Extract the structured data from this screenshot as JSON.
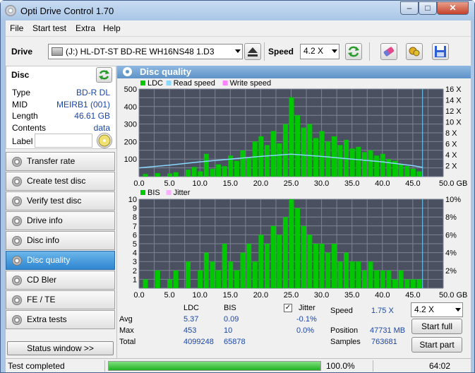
{
  "app": {
    "title": "Opti Drive Control 1.70"
  },
  "window_buttons": {
    "minimize": "–",
    "maximize": "□",
    "close": "✕"
  },
  "menu": [
    "File",
    "Start test",
    "Extra",
    "Help"
  ],
  "toolbar": {
    "drive_label": "Drive",
    "drive_value": "(J:)   HL-DT-ST BD-RE  WH16NS48 1.D3",
    "speed_label": "Speed",
    "speed_value": "4.2 X"
  },
  "disc": {
    "header": "Disc",
    "rows": [
      {
        "label": "Type",
        "value": "BD-R DL"
      },
      {
        "label": "MID",
        "value": "MEIRB1 (001)"
      },
      {
        "label": "Length",
        "value": "46.61 GB"
      },
      {
        "label": "Contents",
        "value": "data"
      }
    ],
    "label_label": "Label",
    "label_value": ""
  },
  "nav": [
    {
      "label": "Transfer rate",
      "active": false
    },
    {
      "label": "Create test disc",
      "active": false
    },
    {
      "label": "Verify test disc",
      "active": false
    },
    {
      "label": "Drive info",
      "active": false
    },
    {
      "label": "Disc info",
      "active": false
    },
    {
      "label": "Disc quality",
      "active": true
    },
    {
      "label": "CD Bler",
      "active": false
    },
    {
      "label": "FE / TE",
      "active": false
    },
    {
      "label": "Extra tests",
      "active": false
    }
  ],
  "status_window_button": "Status window >>",
  "panel": {
    "title": "Disc quality"
  },
  "chart_data": [
    {
      "type": "bar",
      "legend": [
        "LDC",
        "Read speed",
        "Write speed"
      ],
      "colors": {
        "LDC": "#00c800",
        "Read speed": "#88d8ff",
        "Write speed": "#ff80ff",
        "background": "#4a5060",
        "grid": "#7c8494"
      },
      "x_ticks": [
        "0.0",
        "5.0",
        "10.0",
        "15.0",
        "20.0",
        "25.0",
        "30.0",
        "35.0",
        "40.0",
        "45.0",
        "50.0 GB"
      ],
      "y_ticks": [
        "500",
        "400",
        "300",
        "200",
        "100"
      ],
      "y2_ticks": [
        "16 X",
        "14 X",
        "12 X",
        "10 X",
        "8 X",
        "6 X",
        "4 X",
        "2 X"
      ],
      "xlim": [
        0,
        50
      ],
      "ylim": [
        0,
        500
      ],
      "y2lim": [
        0,
        16
      ],
      "x": [
        1,
        3,
        5,
        6,
        8,
        9,
        10,
        11,
        12,
        13,
        14,
        15,
        16,
        17,
        18,
        19,
        20,
        21,
        22,
        23,
        24,
        25,
        26,
        27,
        28,
        29,
        30,
        31,
        32,
        33,
        34,
        35,
        36,
        37,
        38,
        39,
        40,
        41,
        42,
        43,
        44,
        45,
        46
      ],
      "values": [
        15,
        20,
        18,
        25,
        40,
        55,
        30,
        130,
        45,
        70,
        60,
        120,
        90,
        150,
        110,
        200,
        230,
        180,
        260,
        190,
        300,
        453,
        350,
        280,
        300,
        220,
        260,
        200,
        230,
        180,
        210,
        160,
        170,
        140,
        150,
        120,
        130,
        100,
        90,
        70,
        60,
        45,
        30
      ],
      "read_speed": {
        "x": [
          0,
          5,
          10,
          15,
          20,
          25,
          30,
          35,
          40,
          45,
          46.6
        ],
        "y": [
          1.6,
          2.1,
          2.7,
          3.2,
          3.7,
          4.1,
          3.7,
          3.2,
          2.7,
          2.0,
          1.7
        ]
      },
      "marker_x": 46.6
    },
    {
      "type": "bar",
      "legend": [
        "BIS",
        "Jitter"
      ],
      "colors": {
        "BIS": "#00c800",
        "Jitter": "#ffb0ff"
      },
      "x_ticks": [
        "0.0",
        "5.0",
        "10.0",
        "15.0",
        "20.0",
        "25.0",
        "30.0",
        "35.0",
        "40.0",
        "45.0",
        "50.0 GB"
      ],
      "y_ticks": [
        "10",
        "9",
        "8",
        "7",
        "6",
        "5",
        "4",
        "3",
        "2",
        "1"
      ],
      "y2_ticks": [
        "10%",
        "8%",
        "6%",
        "4%",
        "2%"
      ],
      "xlim": [
        0,
        50
      ],
      "ylim": [
        0,
        10
      ],
      "y2lim": [
        0,
        10
      ],
      "x": [
        1,
        3,
        5,
        6,
        8,
        10,
        11,
        12,
        13,
        14,
        15,
        16,
        17,
        18,
        19,
        20,
        21,
        22,
        23,
        24,
        25,
        26,
        27,
        28,
        29,
        30,
        31,
        32,
        33,
        34,
        35,
        36,
        37,
        38,
        39,
        40,
        41,
        42,
        43,
        44,
        45,
        46
      ],
      "values": [
        1,
        2,
        1,
        2,
        3,
        2,
        4,
        3,
        2,
        5,
        3,
        2,
        4,
        5,
        3,
        6,
        5,
        7,
        6,
        8,
        10,
        9,
        7,
        6,
        5,
        5,
        4,
        5,
        3,
        4,
        3,
        3,
        2,
        3,
        2,
        2,
        2,
        1,
        2,
        1,
        1,
        1
      ],
      "marker_x": 46.6
    }
  ],
  "stats": {
    "col_ldc": "LDC",
    "col_bis": "BIS",
    "jitter_label": "Jitter",
    "jitter_checked": true,
    "rows": [
      {
        "label": "Avg",
        "ldc": "5.37",
        "bis": "0.09",
        "jitter": "-0.1%"
      },
      {
        "label": "Max",
        "ldc": "453",
        "bis": "10",
        "jitter": "0.0%"
      },
      {
        "label": "Total",
        "ldc": "4099248",
        "bis": "65878",
        "jitter": ""
      }
    ],
    "speed_label": "Speed",
    "speed_value": "1.75 X",
    "speed_select": "4.2 X",
    "position_label": "Position",
    "position_value": "47731 MB",
    "samples_label": "Samples",
    "samples_value": "763681",
    "start_full": "Start full",
    "start_part": "Start part"
  },
  "status": {
    "text": "Test completed",
    "progress": 1.0,
    "progress_text": "100.0%",
    "time": "64:02"
  }
}
